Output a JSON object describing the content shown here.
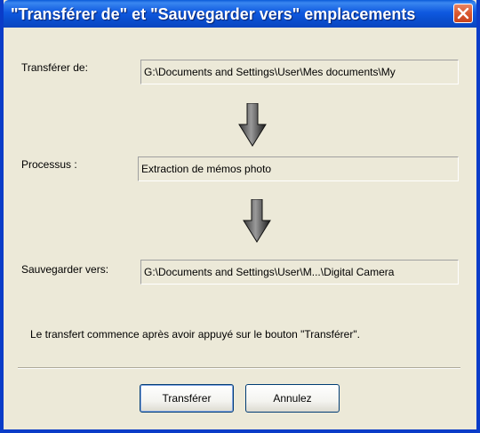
{
  "window": {
    "title": "\"Transférer de\" et \"Sauvegarder vers\" emplacements",
    "close_label": "Close"
  },
  "form": {
    "transfer_from_label": "Transférer de:",
    "transfer_from_value": "G:\\Documents and Settings\\User\\Mes documents\\My",
    "process_label": "Processus :",
    "process_value": "Extraction de mémos photo",
    "save_to_label": "Sauvegarder vers:",
    "save_to_value": "G:\\Documents and Settings\\User\\M...\\Digital Camera"
  },
  "info_text": "Le transfert commence après avoir appuyé sur le bouton \"Transférer\".",
  "buttons": {
    "transfer": "Transférer",
    "cancel": "Annulez"
  },
  "colors": {
    "titlebar": "#0a4fd0",
    "dialog_bg": "#ece9d8",
    "close_red": "#d9582f"
  },
  "icons": [
    "close-icon",
    "down-arrow-icon"
  ]
}
